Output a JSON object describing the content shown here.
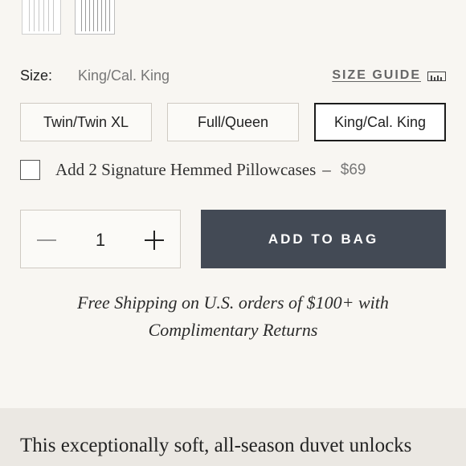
{
  "size": {
    "label": "Size:",
    "selected": "King/Cal. King",
    "guide_label": "SIZE GUIDE",
    "options": [
      "Twin/Twin XL",
      "Full/Queen",
      "King/Cal. King"
    ]
  },
  "addon": {
    "label": "Add 2 Signature Hemmed Pillowcases",
    "separator": "–",
    "price": "$69",
    "checked": false
  },
  "quantity": {
    "value": "1"
  },
  "cart": {
    "button_label": "ADD TO BAG"
  },
  "shipping": {
    "line1": "Free Shipping on U.S. orders of $100+ with",
    "line2": "Complimentary Returns"
  },
  "description": {
    "text": "This exceptionally soft, all-season duvet unlocks"
  },
  "colors": {
    "accent": "#434a55",
    "background": "#f8f6f2",
    "band": "#ebe8e3"
  }
}
